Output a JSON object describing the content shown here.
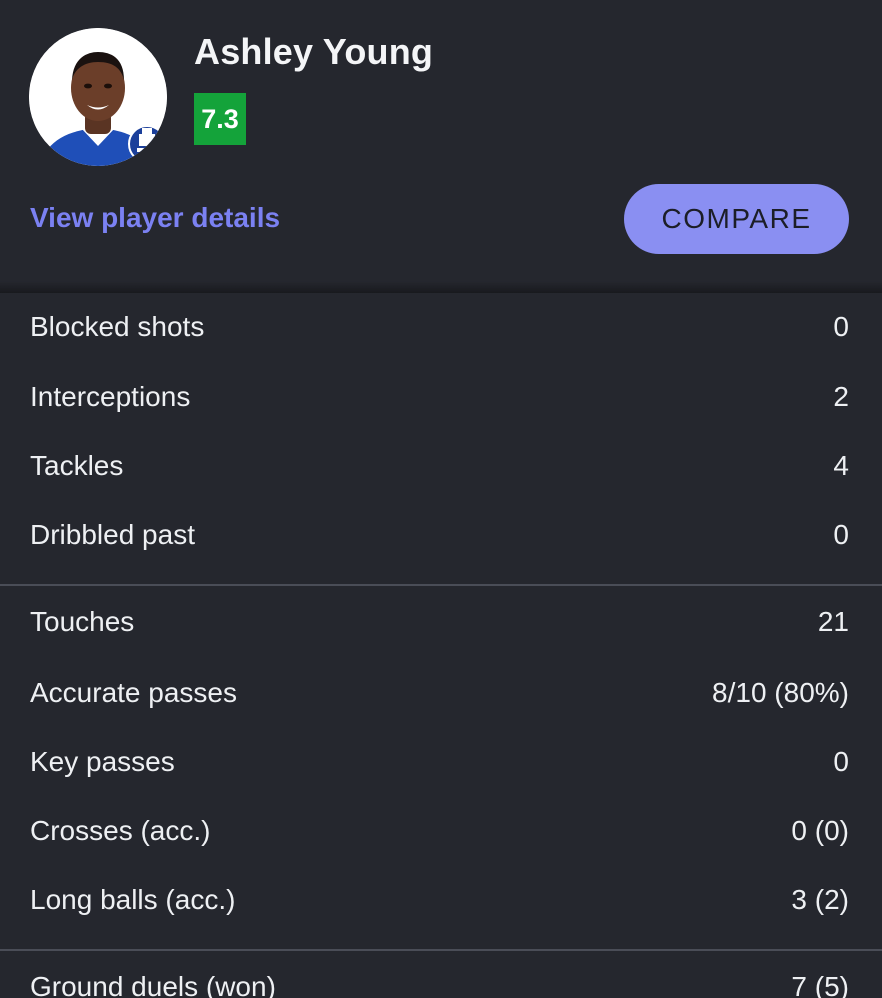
{
  "player": {
    "name": "Ashley Young",
    "rating": "7.3",
    "rating_color": "#14a33a",
    "club_badge_icon": "everton-crest-icon",
    "avatar_icon": "player-photo-avatar"
  },
  "actions": {
    "details_link": "View player details",
    "compare_button": "COMPARE",
    "accent_color": "#8a8ff2",
    "link_color": "#7b81f2"
  },
  "stats": {
    "defending": [
      {
        "label": "Blocked shots",
        "value": "0"
      },
      {
        "label": "Interceptions",
        "value": "2"
      },
      {
        "label": "Tackles",
        "value": "4"
      },
      {
        "label": "Dribbled past",
        "value": "0"
      }
    ],
    "passing": [
      {
        "label": "Touches",
        "value": "21"
      },
      {
        "label": "Accurate passes",
        "value": "8/10 (80%)"
      },
      {
        "label": "Key passes",
        "value": "0"
      },
      {
        "label": "Crosses (acc.)",
        "value": "0 (0)"
      },
      {
        "label": "Long balls (acc.)",
        "value": "3 (2)"
      }
    ],
    "duels": [
      {
        "label": "Ground duels (won)",
        "value": "7 (5)"
      }
    ]
  },
  "theme": {
    "background": "#25272e",
    "divider": "#4a4d57"
  }
}
